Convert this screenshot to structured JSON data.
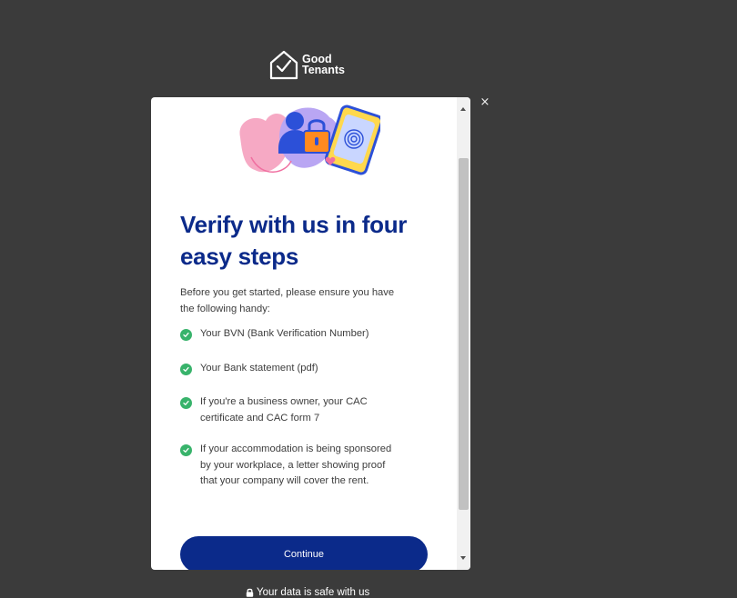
{
  "brand": {
    "name_line1": "Good",
    "name_line2": "Tenants",
    "icon": "house-check-icon"
  },
  "modal": {
    "close_label": "×",
    "heading": "Verify with us in four easy steps",
    "intro": "Before you get started, please ensure you have the following handy:",
    "requirements": [
      {
        "text": "Your BVN (Bank Verification Number)",
        "icon": "check-circle-icon"
      },
      {
        "text": "Your Bank statement (pdf)",
        "icon": "check-circle-icon"
      },
      {
        "text": "If you're a business owner, your CAC certificate and CAC form 7",
        "icon": "check-circle-icon"
      },
      {
        "text": "If your accommodation is being sponsored by your workplace, a letter showing proof that your company will cover the rent.",
        "icon": "check-circle-icon"
      }
    ],
    "continue_label": "Continue",
    "illustration": "security-verification-illustration"
  },
  "footer": {
    "note": "Your data is safe with us",
    "icon": "lock-icon"
  },
  "colors": {
    "backdrop": "#3b3b3b",
    "heading": "#0b2a8a",
    "button": "#0b2a8a",
    "check": "#38b36b",
    "body_text": "#3d3d3d"
  }
}
